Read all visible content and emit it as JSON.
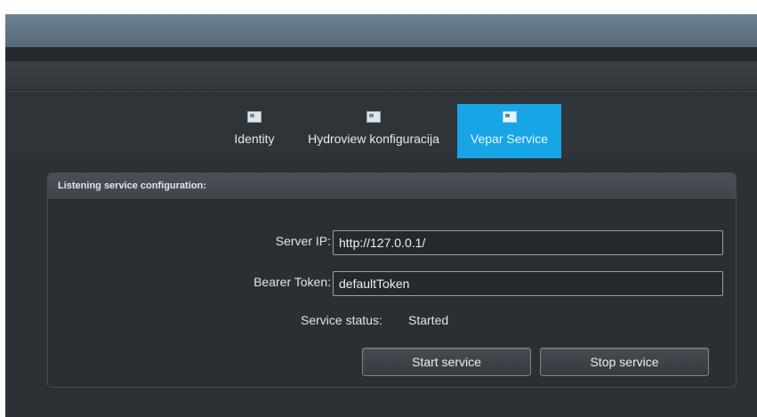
{
  "tabs": [
    {
      "label": "Identity",
      "icon": "identity-card-icon",
      "active": false
    },
    {
      "label": "Hydroview konfiguracija",
      "icon": "config-window-icon",
      "active": false
    },
    {
      "label": "Vepar Service",
      "icon": "service-window-icon",
      "active": true
    }
  ],
  "panel": {
    "title": "Listening service configuration:",
    "server_ip": {
      "label": "Server IP:",
      "value": "http://127.0.0.1/"
    },
    "bearer_token": {
      "label": "Bearer Token:",
      "value": "defaultToken"
    },
    "service_status": {
      "label": "Service status:",
      "value": "Started"
    },
    "start_button": "Start service",
    "stop_button": "Stop service"
  },
  "colors": {
    "accent": "#17a5e6",
    "background": "#2c3136",
    "title_bar": "#5f7383"
  }
}
